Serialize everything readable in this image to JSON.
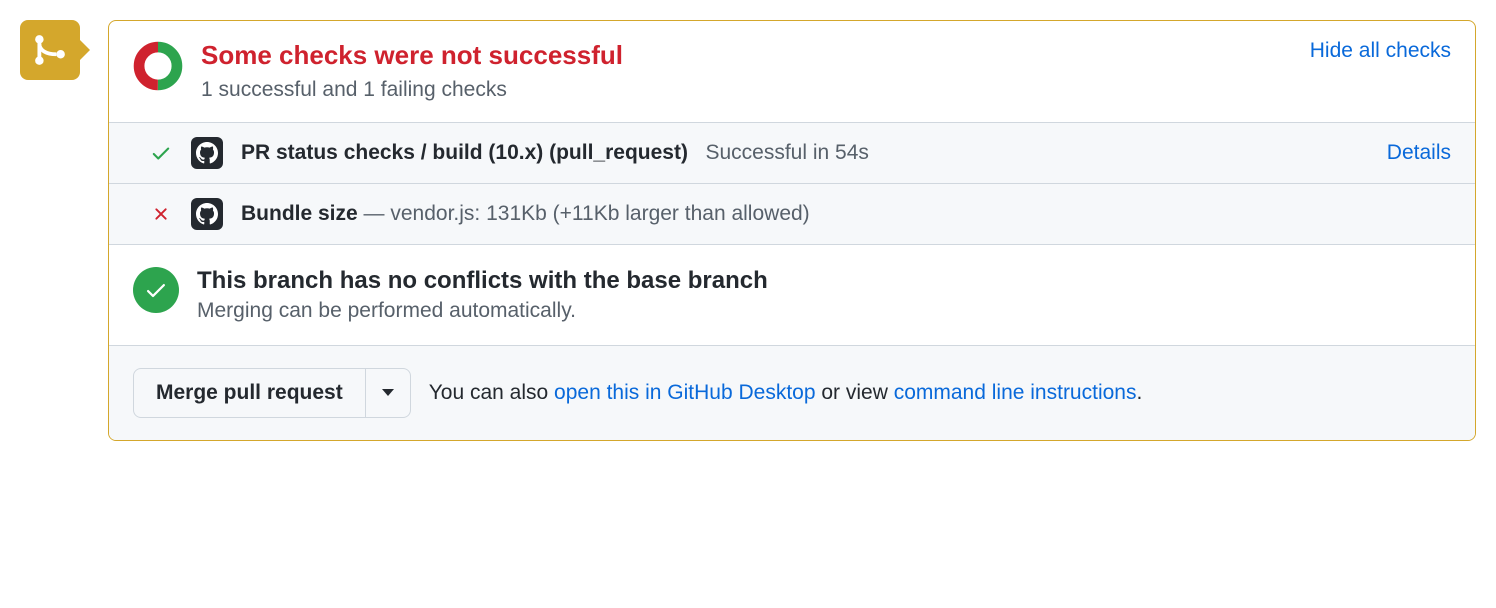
{
  "header": {
    "title": "Some checks were not successful",
    "subtitle": "1 successful and 1 failing checks",
    "hide_link": "Hide all checks"
  },
  "checks": [
    {
      "status": "success",
      "name": "PR status checks / build (10.x) (pull_request)",
      "detail": "Successful in 54s",
      "link": "Details"
    },
    {
      "status": "fail",
      "name": "Bundle size",
      "separator": " — ",
      "detail": "vendor.js: 131Kb (+11Kb larger than allowed)",
      "link": ""
    }
  ],
  "conflicts": {
    "title": "This branch has no conflicts with the base branch",
    "subtitle": "Merging can be performed automatically."
  },
  "footer": {
    "button": "Merge pull request",
    "text_before": "You can also ",
    "link1": "open this in GitHub Desktop",
    "text_mid": " or view ",
    "link2": "command line instructions",
    "text_after": "."
  }
}
